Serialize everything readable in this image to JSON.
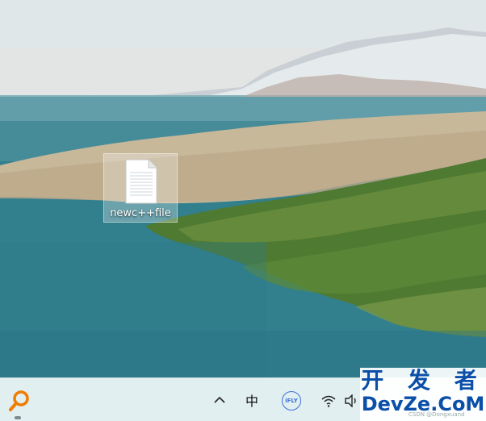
{
  "desktop": {
    "icons": [
      {
        "label": "newc++file",
        "icon": "text-file-icon"
      }
    ]
  },
  "taskbar": {
    "search_icon": "search-icon",
    "tray": {
      "overflow_icon": "chevron-up-icon",
      "ime_label": "中",
      "ifly_label": "iFLY",
      "wifi_icon": "wifi-icon",
      "volume_icon": "speaker-icon"
    }
  },
  "watermark": {
    "line1": "开 发 者",
    "line2": "DevZe.CoM",
    "small": "CSDN @Dongxuand"
  },
  "colors": {
    "taskbar_bg": "#e1eff1",
    "search_accent": "#f07c00",
    "watermark_text": "#0b4fa8"
  }
}
